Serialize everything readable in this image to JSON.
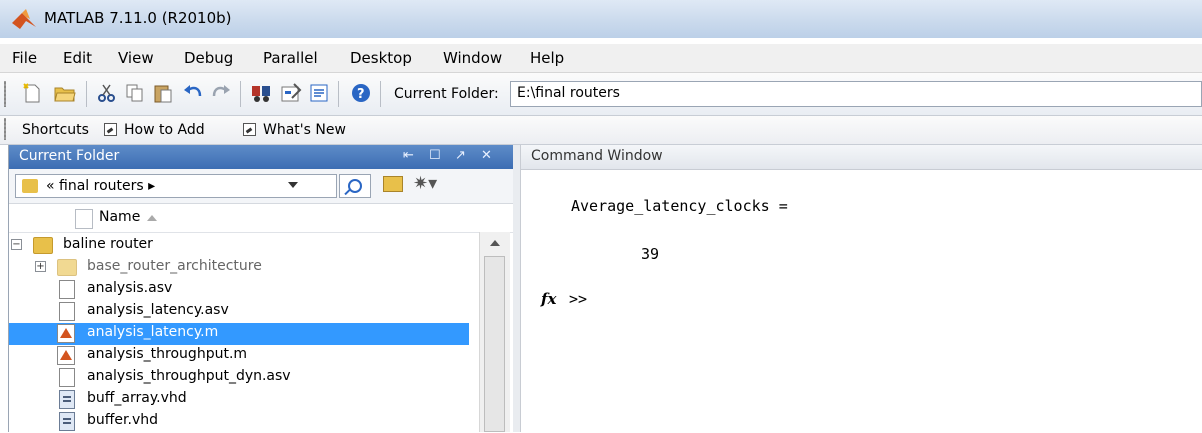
{
  "window": {
    "title": "MATLAB  7.11.0 (R2010b)"
  },
  "menubar": {
    "items": [
      "File",
      "Edit",
      "View",
      "Debug",
      "Parallel",
      "Desktop",
      "Window",
      "Help"
    ]
  },
  "toolbar": {
    "icons": [
      "new-file-icon",
      "open-folder-icon",
      "cut-icon",
      "copy-icon",
      "paste-icon",
      "undo-icon",
      "redo-icon",
      "simulink-icon",
      "guide-icon",
      "profiler-icon",
      "help-icon"
    ],
    "current_folder_label": "Current Folder:",
    "current_folder_path": "E:\\final routers"
  },
  "shortcuts": {
    "label": "Shortcuts",
    "how_to_add": "How to Add",
    "whats_new": "What's New"
  },
  "current_folder_panel": {
    "title": "Current Folder",
    "address": "« final routers  ▸",
    "column_name": "Name",
    "items": [
      {
        "label": "baline router",
        "type": "folder",
        "expander": "−"
      },
      {
        "label": "base_router_architecture",
        "type": "folder",
        "expander": "+"
      },
      {
        "label": "analysis.asv",
        "type": "file"
      },
      {
        "label": "analysis_latency.asv",
        "type": "file"
      },
      {
        "label": "analysis_latency.m",
        "type": "mfile",
        "selected": true
      },
      {
        "label": "analysis_throughput.m",
        "type": "mfile"
      },
      {
        "label": "analysis_throughput_dyn.asv",
        "type": "file"
      },
      {
        "label": "buff_array.vhd",
        "type": "vhd"
      },
      {
        "label": "buffer.vhd",
        "type": "vhd"
      }
    ]
  },
  "command_window": {
    "title": "Command Window",
    "output_var": "Average_latency_clocks =",
    "output_value": "39",
    "fx_label": "fx",
    "prompt": ">>"
  }
}
